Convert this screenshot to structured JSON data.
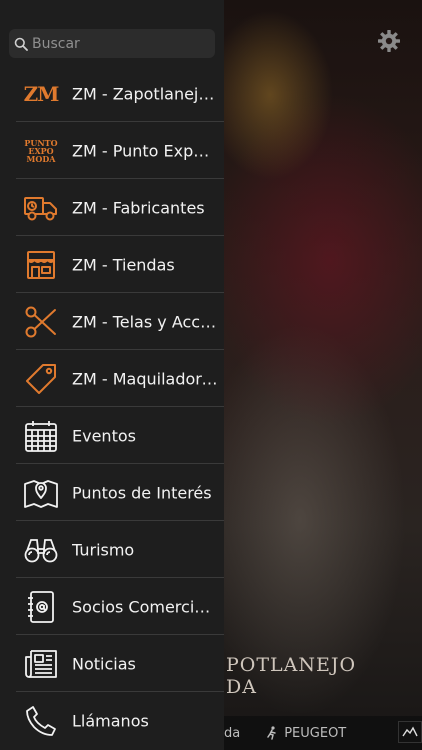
{
  "search": {
    "placeholder": "Buscar"
  },
  "menu": {
    "items": [
      {
        "label": "ZM - Zapotlanejo Moda",
        "icon": "zm-logo-icon"
      },
      {
        "label": "ZM - Punto Expo Moda",
        "icon": "punto-expo-moda-logo-icon"
      },
      {
        "label": "ZM - Fabricantes",
        "icon": "delivery-truck-icon"
      },
      {
        "label": "ZM - Tiendas",
        "icon": "storefront-icon"
      },
      {
        "label": "ZM - Telas y Accesorios",
        "icon": "scissors-icon"
      },
      {
        "label": "ZM - Maquiladores",
        "icon": "price-tag-icon"
      },
      {
        "label": "Eventos",
        "icon": "calendar-icon"
      },
      {
        "label": "Puntos de Interés",
        "icon": "map-pin-icon"
      },
      {
        "label": "Turismo",
        "icon": "binoculars-icon"
      },
      {
        "label": "Socios Comerciales",
        "icon": "address-book-icon"
      },
      {
        "label": "Noticias",
        "icon": "newspaper-icon"
      },
      {
        "label": "Llámanos",
        "icon": "phone-icon"
      }
    ],
    "logos": {
      "zm": "ZM",
      "pem_line1": "PUNTO",
      "pem_line2": "EXPO",
      "pem_line3": "MODA"
    }
  },
  "background": {
    "title": "POTLANEJO\nDA",
    "bottom_bar": {
      "item1": "da",
      "item2": "PEUGEOT"
    }
  },
  "colors": {
    "accent": "#e07a2e",
    "drawer_bg": "#1e1e1e",
    "separator": "#3a3a3a",
    "text": "#f2f2f2"
  }
}
